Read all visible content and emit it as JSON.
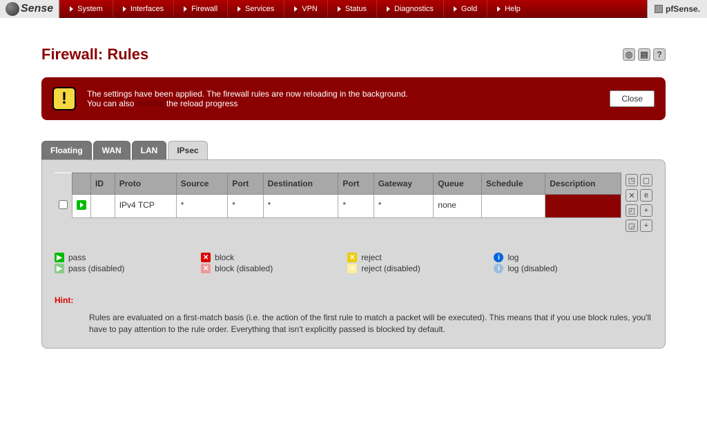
{
  "brand": {
    "text": "Sense"
  },
  "hostname": "pfSense.",
  "nav": [
    "System",
    "Interfaces",
    "Firewall",
    "Services",
    "VPN",
    "Status",
    "Diagnostics",
    "Gold",
    "Help"
  ],
  "page": {
    "title": "Firewall: Rules"
  },
  "alert": {
    "line1": "The settings have been applied. The firewall rules are now reloading in the background.",
    "line2a": "You can also ",
    "monitor": "monitor",
    "line2b": " the reload progress",
    "close": "Close"
  },
  "tabs": [
    "Floating",
    "WAN",
    "LAN",
    "IPsec"
  ],
  "activeTab": 3,
  "table": {
    "headers": [
      "ID",
      "Proto",
      "Source",
      "Port",
      "Destination",
      "Port",
      "Gateway",
      "Queue",
      "Schedule",
      "Description"
    ],
    "rows": [
      {
        "id": "",
        "proto": "IPv4 TCP",
        "source": "*",
        "sport": "*",
        "dest": "*",
        "dport": "*",
        "gateway": "*",
        "queue": "none",
        "schedule": "",
        "description": ""
      }
    ]
  },
  "legend": {
    "pass": "pass",
    "passD": "pass (disabled)",
    "block": "block",
    "blockD": "block (disabled)",
    "reject": "reject",
    "rejectD": "reject (disabled)",
    "log": "log",
    "logD": "log (disabled)"
  },
  "hint": {
    "label": "Hint:",
    "text": "Rules are evaluated on a first-match basis (i.e. the action of the first rule to match a packet will be executed). This means that if you use block rules, you'll have to pay attention to the rule order. Everything that isn't explicitly passed is blocked by default."
  }
}
